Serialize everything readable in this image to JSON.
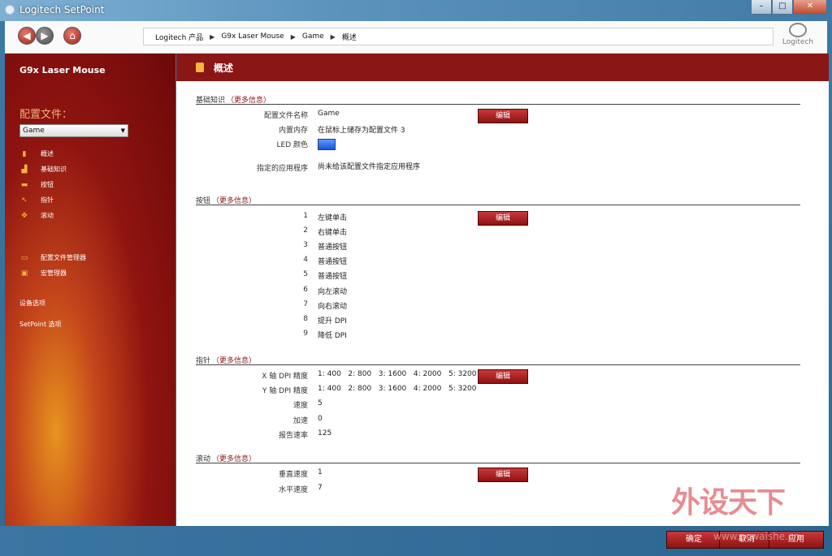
{
  "window": {
    "title": "Logitech SetPoint",
    "buttons": [
      "–",
      "□",
      "✕"
    ]
  },
  "header": {
    "breadcrumb": [
      "Logitech 产品",
      "G9x Laser Mouse",
      "Game",
      "概述"
    ],
    "logo_text": "Logitech"
  },
  "sidebar": {
    "device": "G9x Laser Mouse",
    "profile_label": "配置文件：",
    "profile_value": "Game",
    "nav": [
      {
        "label": "概述",
        "icon": "overview-icon"
      },
      {
        "label": "基础知识",
        "icon": "basics-icon"
      },
      {
        "label": "按钮",
        "icon": "buttons-icon"
      },
      {
        "label": "指针",
        "icon": "pointer-icon"
      },
      {
        "label": "滚动",
        "icon": "scroll-icon"
      }
    ],
    "tools": [
      {
        "label": "配置文件管理器",
        "icon": "profile-manager-icon"
      },
      {
        "label": "宏管理器",
        "icon": "macro-manager-icon"
      }
    ],
    "device_options": "设备选项",
    "setpoint_options": "SetPoint 选项"
  },
  "main": {
    "title": "概述",
    "edit_label": "编辑",
    "more_info": "（更多信息）",
    "basics": {
      "heading": "基础知识",
      "rows": [
        {
          "k": "配置文件名称",
          "v": "Game"
        },
        {
          "k": "内置内存",
          "v": "在鼠标上储存为配置文件 3"
        },
        {
          "k": "LED 颜色",
          "v": ""
        },
        {
          "k": "指定的应用程序",
          "v": "尚未给该配置文件指定应用程序"
        }
      ]
    },
    "buttons": {
      "heading": "按钮",
      "rows": [
        {
          "k": "1",
          "v": "左键单击"
        },
        {
          "k": "2",
          "v": "右键单击"
        },
        {
          "k": "3",
          "v": "普通按钮"
        },
        {
          "k": "4",
          "v": "普通按钮"
        },
        {
          "k": "5",
          "v": "普通按钮"
        },
        {
          "k": "6",
          "v": "向左滚动"
        },
        {
          "k": "7",
          "v": "向右滚动"
        },
        {
          "k": "8",
          "v": "提升 DPI"
        },
        {
          "k": "9",
          "v": "降低 DPI"
        }
      ]
    },
    "pointer": {
      "heading": "指针",
      "rows": [
        {
          "k": "X 轴 DPI 精度",
          "v": "1: 400   2: 800   3: 1600   4: 2000   5: 3200"
        },
        {
          "k": "Y 轴 DPI 精度",
          "v": "1: 400   2: 800   3: 1600   4: 2000   5: 3200"
        },
        {
          "k": "速度",
          "v": "5"
        },
        {
          "k": "加速",
          "v": "0"
        },
        {
          "k": "报告速率",
          "v": "125"
        }
      ]
    },
    "scroll": {
      "heading": "滚动",
      "rows": [
        {
          "k": "垂直速度",
          "v": "1"
        },
        {
          "k": "水平速度",
          "v": "7"
        }
      ]
    }
  },
  "footer": {
    "ok": "确定",
    "cancel": "取消",
    "apply": "应用"
  },
  "watermark": {
    "text": "外设天下",
    "url": "www.pcwaishe.cn"
  },
  "colors": {
    "accent": "#8b1616",
    "led": "#1a55d9"
  }
}
